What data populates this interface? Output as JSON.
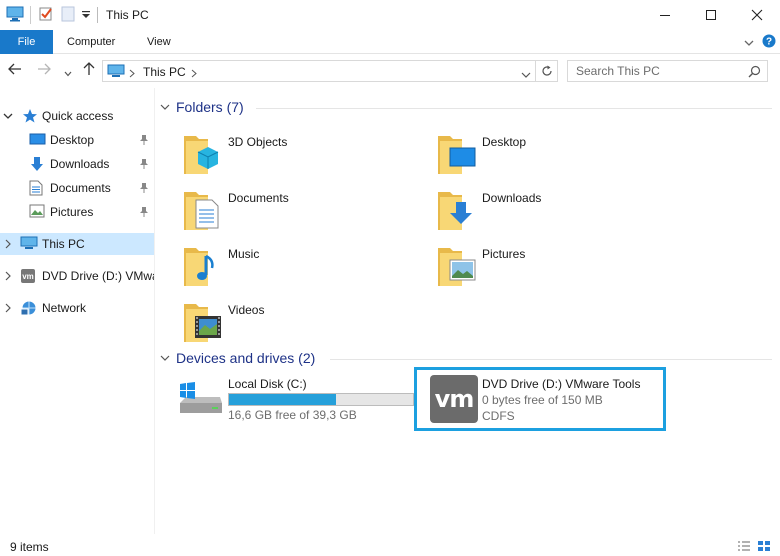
{
  "window": {
    "title": "This PC"
  },
  "ribbon": {
    "tabs": [
      "File",
      "Computer",
      "View"
    ]
  },
  "address": {
    "path": "This PC",
    "search_placeholder": "Search This PC"
  },
  "sidebar": {
    "items": [
      {
        "label": "Quick access"
      },
      {
        "label": "Desktop"
      },
      {
        "label": "Downloads"
      },
      {
        "label": "Documents"
      },
      {
        "label": "Pictures"
      },
      {
        "label": "This PC"
      },
      {
        "label": "DVD Drive (D:) VMware Tools"
      },
      {
        "label": "Network"
      }
    ]
  },
  "folders": {
    "header": "Folders (7)",
    "items": [
      "3D Objects",
      "Desktop",
      "Documents",
      "Downloads",
      "Music",
      "Pictures",
      "Videos"
    ]
  },
  "devices": {
    "header": "Devices and drives (2)",
    "local": {
      "name": "Local Disk (C:)",
      "free": "16,6 GB free of 39,3 GB",
      "used_fraction": 0.58
    },
    "dvd": {
      "name": "DVD Drive (D:) VMware Tools",
      "free": "0 bytes free of 150 MB",
      "fs": "CDFS",
      "logo": "vm"
    }
  },
  "status": {
    "count": "9 items"
  },
  "colors": {
    "accent": "#1979ca",
    "selected": "#cce8ff",
    "header": "#1e3287",
    "highlight": "#1ca0e0",
    "folder": "#f8d775"
  }
}
